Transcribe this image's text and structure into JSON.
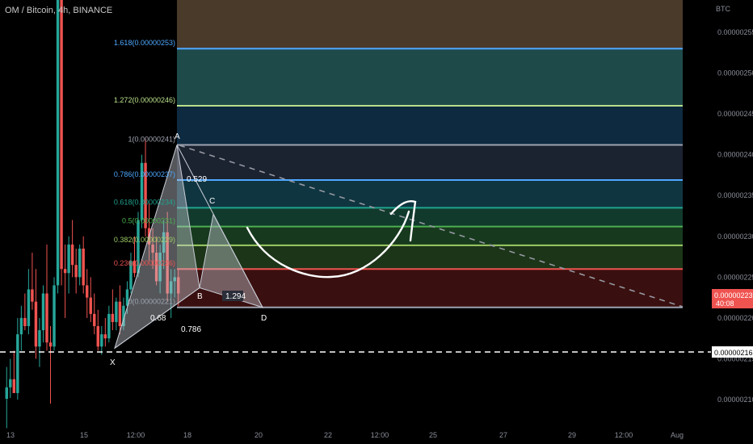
{
  "header": {
    "title": "OM / Bitcoin, 4h, BINANCE"
  },
  "price_axis": {
    "currency": "BTC",
    "ticks": [
      "0.00000255",
      "0.00000250",
      "0.00000245",
      "0.00000240",
      "0.00000235",
      "0.00000230",
      "0.00000225",
      "0.00000220",
      "0.00000215",
      "0.00000210"
    ],
    "last_price": "0.00000223",
    "countdown": "40:08",
    "dashed_level": "0.00000216"
  },
  "time_axis": {
    "ticks": [
      "13",
      "15",
      "12:00",
      "18",
      "20",
      "22",
      "12:00",
      "25",
      "27",
      "29",
      "12:00",
      "Aug"
    ]
  },
  "chart_data": {
    "type": "candlestick",
    "symbol": "OM / Bitcoin",
    "timeframe": "4h",
    "exchange": "BINANCE",
    "ylim": [
      2.06e-06,
      2.58e-06
    ],
    "fib_levels": [
      {
        "ratio": "1.618",
        "label": "1.618(0.00000253)",
        "price": 2.53e-06,
        "color": "#4ea8ff"
      },
      {
        "ratio": "1.272",
        "label": "1.272(0.00000246)",
        "price": 2.46e-06,
        "color": "#b9e08a"
      },
      {
        "ratio": "1",
        "label": "1(0.00000241)",
        "price": 2.412e-06,
        "color": "#9ea3b0"
      },
      {
        "ratio": "0.786",
        "label": "0.786(0.00000237)",
        "price": 2.369e-06,
        "color": "#4ea8ff"
      },
      {
        "ratio": "0.618",
        "label": "0.618(0.00000234)",
        "price": 2.335e-06,
        "color": "#21a38f"
      },
      {
        "ratio": "0.5",
        "label": "0.5(0.00000231)",
        "price": 2.312e-06,
        "color": "#4caf50"
      },
      {
        "ratio": "0.382",
        "label": "0.382(0.00000229)",
        "price": 2.289e-06,
        "color": "#9ccc65"
      },
      {
        "ratio": "0.236",
        "label": "0.236(0.00000226)",
        "price": 2.26e-06,
        "color": "#ef5350"
      },
      {
        "ratio": "0",
        "label": "0(0.00000221)",
        "price": 2.213e-06,
        "color": "#9ea3b0"
      }
    ],
    "harmonic_points": [
      {
        "label": "X",
        "price": 2.163e-06
      },
      {
        "label": "A",
        "price": 2.412e-06
      },
      {
        "label": "B",
        "price": 2.237e-06
      },
      {
        "label": "C",
        "price": 2.327e-06
      },
      {
        "label": "D",
        "price": 2.213e-06
      }
    ],
    "harmonic_ratios": [
      "0.529",
      "0.68",
      "0.786",
      "1.294"
    ],
    "candles": [
      {
        "o": 2.101,
        "h": 2.14,
        "l": 2.065,
        "c": 2.115
      },
      {
        "o": 2.115,
        "h": 2.15,
        "l": 2.102,
        "c": 2.125
      },
      {
        "o": 2.125,
        "h": 2.16,
        "l": 2.11,
        "c": 2.108
      },
      {
        "o": 2.108,
        "h": 2.2,
        "l": 2.1,
        "c": 2.18
      },
      {
        "o": 2.18,
        "h": 2.215,
        "l": 2.16,
        "c": 2.2
      },
      {
        "o": 2.2,
        "h": 2.23,
        "l": 2.185,
        "c": 2.19
      },
      {
        "o": 2.19,
        "h": 2.26,
        "l": 2.18,
        "c": 2.235
      },
      {
        "o": 2.235,
        "h": 2.28,
        "l": 2.21,
        "c": 2.22
      },
      {
        "o": 2.22,
        "h": 2.26,
        "l": 2.15,
        "c": 2.165
      },
      {
        "o": 2.165,
        "h": 2.2,
        "l": 2.14,
        "c": 2.185
      },
      {
        "o": 2.185,
        "h": 2.24,
        "l": 2.17,
        "c": 2.23
      },
      {
        "o": 2.23,
        "h": 2.29,
        "l": 2.16,
        "c": 2.17
      },
      {
        "o": 2.17,
        "h": 2.19,
        "l": 2.095,
        "c": 2.165
      },
      {
        "o": 2.165,
        "h": 2.25,
        "l": 2.16,
        "c": 2.24
      },
      {
        "o": 2.24,
        "h": 2.6,
        "l": 2.23,
        "c": 2.59
      },
      {
        "o": 2.59,
        "h": 2.6,
        "l": 2.24,
        "c": 2.26
      },
      {
        "o": 2.26,
        "h": 2.29,
        "l": 2.2,
        "c": 2.255
      },
      {
        "o": 2.255,
        "h": 2.3,
        "l": 2.23,
        "c": 2.29
      },
      {
        "o": 2.29,
        "h": 2.32,
        "l": 2.25,
        "c": 2.265
      },
      {
        "o": 2.265,
        "h": 2.285,
        "l": 2.23,
        "c": 2.25
      },
      {
        "o": 2.25,
        "h": 2.29,
        "l": 2.24,
        "c": 2.285
      },
      {
        "o": 2.285,
        "h": 2.3,
        "l": 2.23,
        "c": 2.24
      },
      {
        "o": 2.24,
        "h": 2.26,
        "l": 2.2,
        "c": 2.225
      },
      {
        "o": 2.225,
        "h": 2.25,
        "l": 2.195,
        "c": 2.205
      },
      {
        "o": 2.205,
        "h": 2.23,
        "l": 2.18,
        "c": 2.19
      },
      {
        "o": 2.19,
        "h": 2.21,
        "l": 2.16,
        "c": 2.165
      },
      {
        "o": 2.165,
        "h": 2.19,
        "l": 2.155,
        "c": 2.18
      },
      {
        "o": 2.18,
        "h": 2.2,
        "l": 2.165,
        "c": 2.175
      },
      {
        "o": 2.175,
        "h": 2.215,
        "l": 2.17,
        "c": 2.205
      },
      {
        "o": 2.205,
        "h": 2.235,
        "l": 2.185,
        "c": 2.195
      },
      {
        "o": 2.195,
        "h": 2.225,
        "l": 2.185,
        "c": 2.22
      },
      {
        "o": 2.22,
        "h": 2.24,
        "l": 2.18,
        "c": 2.19
      },
      {
        "o": 2.19,
        "h": 2.225,
        "l": 2.185,
        "c": 2.215
      },
      {
        "o": 2.215,
        "h": 2.245,
        "l": 2.205,
        "c": 2.235
      },
      {
        "o": 2.235,
        "h": 2.28,
        "l": 2.23,
        "c": 2.27
      },
      {
        "o": 2.27,
        "h": 2.3,
        "l": 2.25,
        "c": 2.255
      },
      {
        "o": 2.255,
        "h": 2.33,
        "l": 2.25,
        "c": 2.32
      },
      {
        "o": 2.32,
        "h": 2.4,
        "l": 2.31,
        "c": 2.39
      },
      {
        "o": 2.39,
        "h": 2.42,
        "l": 2.3,
        "c": 2.31
      },
      {
        "o": 2.31,
        "h": 2.34,
        "l": 2.27,
        "c": 2.29
      },
      {
        "o": 2.29,
        "h": 2.31,
        "l": 2.26,
        "c": 2.28
      },
      {
        "o": 2.28,
        "h": 2.3,
        "l": 2.24,
        "c": 2.245
      },
      {
        "o": 2.245,
        "h": 2.29,
        "l": 2.23,
        "c": 2.28
      },
      {
        "o": 2.28,
        "h": 2.32,
        "l": 2.26,
        "c": 2.305
      },
      {
        "o": 2.305,
        "h": 2.33,
        "l": 2.22,
        "c": 2.23
      },
      {
        "o": 2.23,
        "h": 2.26,
        "l": 2.2,
        "c": 2.245
      },
      {
        "o": 2.245,
        "h": 2.26,
        "l": 2.225,
        "c": 2.25
      },
      {
        "o": 2.25,
        "h": 2.26,
        "l": 2.215,
        "c": 2.23
      }
    ]
  },
  "colors": {
    "up": "#26a69a",
    "down": "#ef5350",
    "background": "#000000"
  }
}
